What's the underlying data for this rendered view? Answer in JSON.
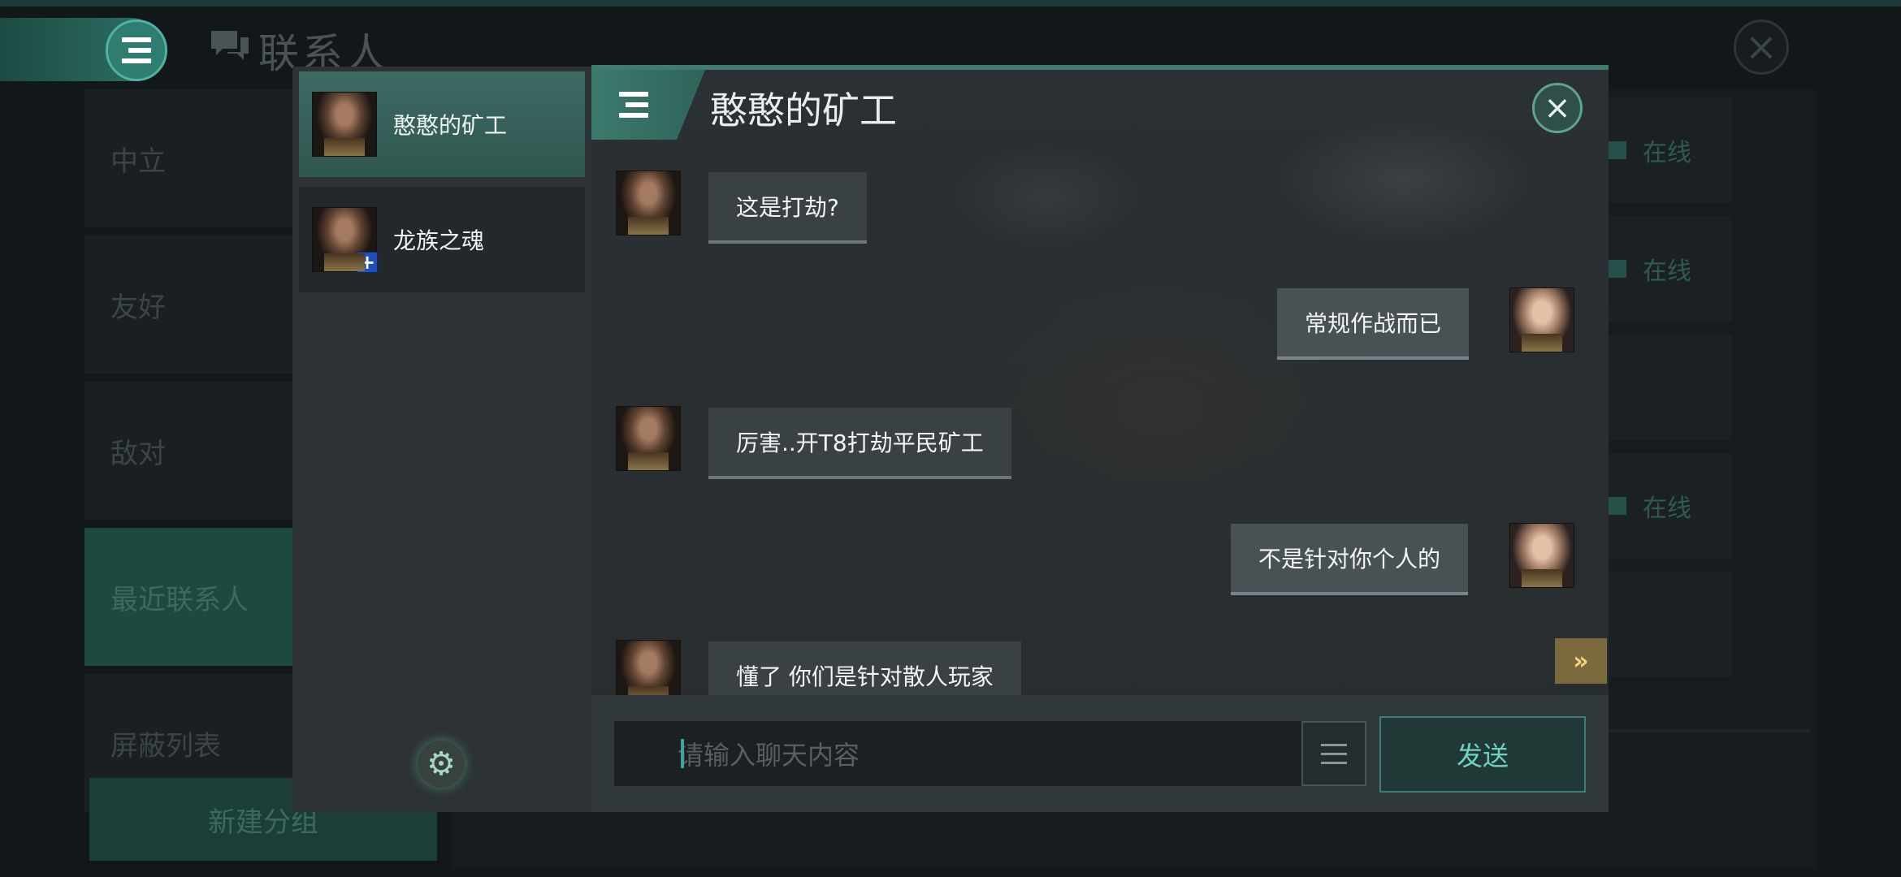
{
  "background": {
    "title": "联系人",
    "groups": [
      "中立",
      "友好",
      "敌对",
      "最近联系人",
      "屏蔽列表"
    ],
    "new_group_label": "新建分组",
    "online_status": [
      "在线",
      "在线",
      "在线"
    ]
  },
  "contacts": [
    {
      "name": "憨憨的矿工"
    },
    {
      "name": "龙族之魂"
    }
  ],
  "chat": {
    "title": "憨憨的矿工",
    "messages": [
      {
        "side": "left",
        "text": "这是打劫?"
      },
      {
        "side": "right",
        "text": "常规作战而已"
      },
      {
        "side": "left",
        "text": "厉害..开T8打劫平民矿工"
      },
      {
        "side": "right",
        "text": "不是针对你个人的"
      },
      {
        "side": "left",
        "text": "懂了 你们是针对散人玩家"
      }
    ],
    "input_placeholder": "请输入聊天内容",
    "send_label": "发送"
  },
  "icons": {
    "menu": "menu-icon",
    "chat": "chat-bubble-icon",
    "close": "close-icon",
    "settings": "gear-icon",
    "add": "plus-icon",
    "scroll_down": "chevron-double-down-icon",
    "quick_phrase": "list-icon"
  },
  "colors": {
    "accent": "#3f7c6f",
    "send_text": "#6fd4bb",
    "scroll_button": "#7a6a3e"
  }
}
